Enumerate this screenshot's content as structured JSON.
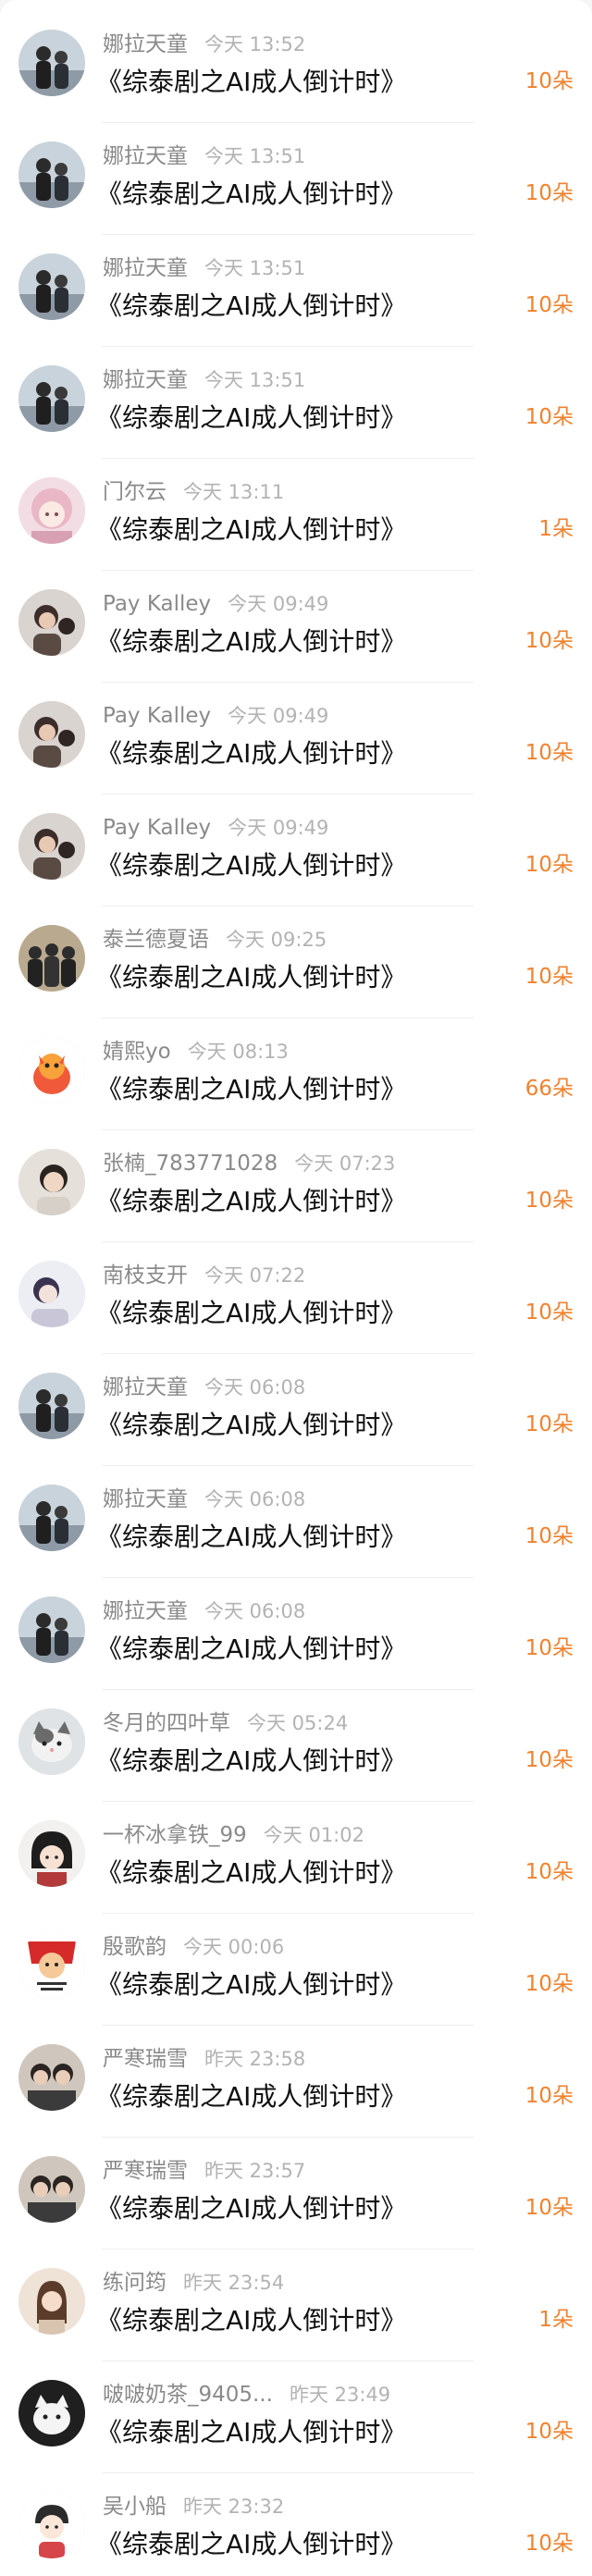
{
  "accent_color": "#f0822e",
  "items": [
    {
      "name": "娜拉天童",
      "time": "今天 13:52",
      "title": "《综泰剧之AI成人倒计时》",
      "count": "10朵",
      "avatar": "photo-couple-avatar"
    },
    {
      "name": "娜拉天童",
      "time": "今天 13:51",
      "title": "《综泰剧之AI成人倒计时》",
      "count": "10朵",
      "avatar": "photo-couple-avatar"
    },
    {
      "name": "娜拉天童",
      "time": "今天 13:51",
      "title": "《综泰剧之AI成人倒计时》",
      "count": "10朵",
      "avatar": "photo-couple-avatar"
    },
    {
      "name": "娜拉天童",
      "time": "今天 13:51",
      "title": "《综泰剧之AI成人倒计时》",
      "count": "10朵",
      "avatar": "photo-couple-avatar"
    },
    {
      "name": "门尔云",
      "time": "今天 13:11",
      "title": "《综泰剧之AI成人倒计时》",
      "count": "1朵",
      "avatar": "anime-girl-avatar"
    },
    {
      "name": "Pay Kalley",
      "time": "今天 09:49",
      "title": "《综泰剧之AI成人倒计时》",
      "count": "10朵",
      "avatar": "photo-portrait-avatar"
    },
    {
      "name": "Pay Kalley",
      "time": "今天 09:49",
      "title": "《综泰剧之AI成人倒计时》",
      "count": "10朵",
      "avatar": "photo-portrait-avatar"
    },
    {
      "name": "Pay Kalley",
      "time": "今天 09:49",
      "title": "《综泰剧之AI成人倒计时》",
      "count": "10朵",
      "avatar": "photo-portrait-avatar"
    },
    {
      "name": "泰兰德夏语",
      "time": "今天 09:25",
      "title": "《综泰剧之AI成人倒计时》",
      "count": "10朵",
      "avatar": "photo-group-avatar"
    },
    {
      "name": "婧熙yo",
      "time": "今天 08:13",
      "title": "《综泰剧之AI成人倒计时》",
      "count": "66朵",
      "avatar": "cartoon-dragon-avatar"
    },
    {
      "name": "张楠_783771028",
      "time": "今天 07:23",
      "title": "《综泰剧之AI成人倒计时》",
      "count": "10朵",
      "avatar": "photo-selfie-avatar"
    },
    {
      "name": "南枝支开",
      "time": "今天 07:22",
      "title": "《综泰剧之AI成人倒计时》",
      "count": "10朵",
      "avatar": "photo-soft-portrait-avatar"
    },
    {
      "name": "娜拉天童",
      "time": "今天 06:08",
      "title": "《综泰剧之AI成人倒计时》",
      "count": "10朵",
      "avatar": "photo-couple-avatar"
    },
    {
      "name": "娜拉天童",
      "time": "今天 06:08",
      "title": "《综泰剧之AI成人倒计时》",
      "count": "10朵",
      "avatar": "photo-couple-avatar"
    },
    {
      "name": "娜拉天童",
      "time": "今天 06:08",
      "title": "《综泰剧之AI成人倒计时》",
      "count": "10朵",
      "avatar": "photo-couple-avatar"
    },
    {
      "name": "冬月的四叶草",
      "time": "今天 05:24",
      "title": "《综泰剧之AI成人倒计时》",
      "count": "10朵",
      "avatar": "photo-cat-avatar"
    },
    {
      "name": "一杯冰拿铁_99",
      "time": "今天 01:02",
      "title": "《综泰剧之AI成人倒计时》",
      "count": "10朵",
      "avatar": "anime-boy-avatar"
    },
    {
      "name": "殷歌韵",
      "time": "今天 00:06",
      "title": "《综泰剧之AI成人倒计时》",
      "count": "10朵",
      "avatar": "meme-red-avatar"
    },
    {
      "name": "严寒瑞雪",
      "time": "昨天 23:58",
      "title": "《综泰剧之AI成人倒计时》",
      "count": "10朵",
      "avatar": "photo-duo-avatar"
    },
    {
      "name": "严寒瑞雪",
      "time": "昨天 23:57",
      "title": "《综泰剧之AI成人倒计时》",
      "count": "10朵",
      "avatar": "photo-duo-avatar"
    },
    {
      "name": "练问筠",
      "time": "昨天 23:54",
      "title": "《综泰剧之AI成人倒计时》",
      "count": "1朵",
      "avatar": "photo-girl-avatar"
    },
    {
      "name": "啵啵奶茶_9405...",
      "time": "昨天 23:49",
      "title": "《综泰剧之AI成人倒计时》",
      "count": "10朵",
      "avatar": "photo-dark-cat-avatar"
    },
    {
      "name": "吴小船",
      "time": "昨天 23:32",
      "title": "《综泰剧之AI成人倒计时》",
      "count": "10朵",
      "avatar": "cartoon-boy-avatar"
    }
  ]
}
